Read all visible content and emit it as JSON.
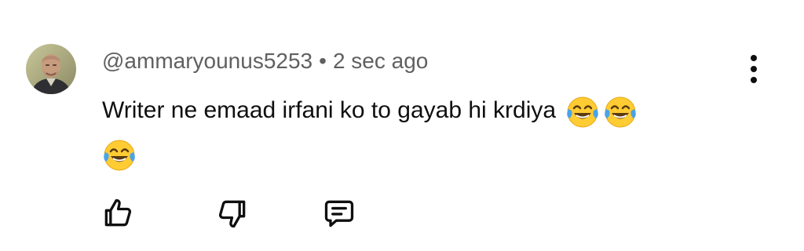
{
  "comment": {
    "author_handle": "@ammaryounus5253",
    "separator": "•",
    "timestamp": "2 sec ago",
    "text": "Writer ne emaad irfani ko to gayab hi krdiya",
    "emojis": [
      "face-with-tears-of-joy",
      "face-with-tears-of-joy",
      "face-with-tears-of-joy"
    ]
  },
  "icons": {
    "more": "more-vertical-icon",
    "like": "thumbs-up-icon",
    "dislike": "thumbs-down-icon",
    "reply": "reply-comment-icon"
  },
  "colors": {
    "text": "#0f0f0f",
    "meta": "#606060",
    "emoji_face": "#ffcc33",
    "emoji_tear": "#4aa3e8"
  }
}
